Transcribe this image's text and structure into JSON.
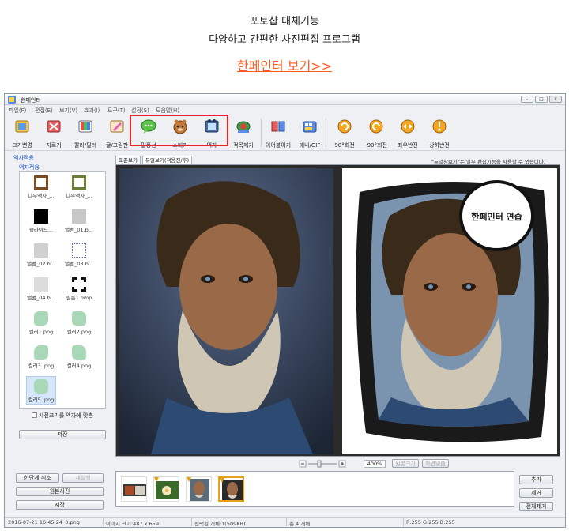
{
  "promo": {
    "line1": "포토샵 대체기능",
    "line2": "다양하고 간편한 사진편집 프로그램",
    "link": "한페인터 보기>>"
  },
  "window": {
    "title": "한페인터",
    "controls": [
      "-",
      "□",
      "x"
    ]
  },
  "menu": [
    "파일(F)",
    "편집(E)",
    "보기(V)",
    "효과(I)",
    "도구(T)",
    "설정(S)",
    "도움말(H)"
  ],
  "toolbar": [
    {
      "label": "크기변경",
      "icon": "resize-icon"
    },
    {
      "label": "자르기",
      "icon": "crop-icon"
    },
    {
      "label": "칼라/필터",
      "icon": "color-filter-icon"
    },
    {
      "label": "글/그림판",
      "icon": "text-draw-icon"
    },
    {
      "label": "말풍선",
      "icon": "speech-bubble-icon"
    },
    {
      "label": "스티커",
      "icon": "sticker-icon"
    },
    {
      "label": "액자",
      "icon": "frame-icon"
    },
    {
      "label": "적목제거",
      "icon": "red-eye-icon"
    },
    {
      "label": "이어붙이기",
      "icon": "merge-icon"
    },
    {
      "label": "애니/GIF",
      "icon": "gif-icon"
    },
    {
      "label": "90°회전",
      "icon": "rotate-right-icon"
    },
    {
      "label": "-90°회전",
      "icon": "rotate-left-icon"
    },
    {
      "label": "좌우반전",
      "icon": "flip-horizontal-icon"
    },
    {
      "label": "상하반전",
      "icon": "flip-vertical-icon"
    }
  ],
  "left_panel": {
    "header": "액자적용",
    "tab": "액자적용",
    "items": [
      {
        "label": "나무액자_...",
        "swatch": "#7a4a20",
        "kind": "frame"
      },
      {
        "label": "나무액자_...",
        "swatch": "#6c7d3a",
        "kind": "frame"
      },
      {
        "label": "슬라이드...",
        "swatch": "#000000",
        "kind": "solid"
      },
      {
        "label": "앨범_01.b...",
        "swatch": "#c8c8c8",
        "kind": "solid"
      },
      {
        "label": "앨범_02.b...",
        "swatch": "#d0d0d0",
        "kind": "solid"
      },
      {
        "label": "앨범_03.b...",
        "swatch": "#ffffff",
        "kind": "dotted"
      },
      {
        "label": "앨범_04.b...",
        "swatch": "#dcdcdc",
        "kind": "solid"
      },
      {
        "label": "필름1.bmp",
        "swatch": "#111111",
        "kind": "film"
      },
      {
        "label": "컬러1.png",
        "swatch": "#a9d8b8",
        "kind": "blob"
      },
      {
        "label": "컬러2.png",
        "swatch": "#a9d8b8",
        "kind": "blob"
      },
      {
        "label": "컬러3 .png",
        "swatch": "#a9d8b8",
        "kind": "blob"
      },
      {
        "label": "컬러4.png",
        "swatch": "#a9d8b8",
        "kind": "blob"
      },
      {
        "label": "컬러5 .png",
        "swatch": "#a9d8b8",
        "kind": "blob"
      }
    ],
    "checkbox_label": "사진크기를 액자에 맞춤",
    "save_button": "저장"
  },
  "view": {
    "tabs": [
      "표준보기",
      "듀얼보기(적용전/후)"
    ],
    "note": "\"듀얼창보기\"는 일부 편집기능을 사용할 수 없습니다.",
    "bubble_text": "한페인터 연습"
  },
  "zoom": {
    "value": "400%",
    "buttons": [
      "원본크기",
      "화면맞춤"
    ]
  },
  "bottom_left_buttons": {
    "undo": "한단계 취소",
    "redo": "재실행",
    "original": "원본사진",
    "save": "저장"
  },
  "bottom_right_buttons": [
    "추가",
    "제거",
    "전체제거"
  ],
  "status": {
    "file": "2016-07-21 16:45:24_0.png",
    "image_size": "이미지 크기:487 x 659",
    "selected": "선택된 개체:1(509KB)",
    "count": "총 4 개체",
    "rgb": "R:255 G:255 B:255"
  },
  "colors": {
    "accent_red": "#e8232a",
    "link_orange": "#ff5a1f",
    "panel_blue": "#1f56c9"
  }
}
